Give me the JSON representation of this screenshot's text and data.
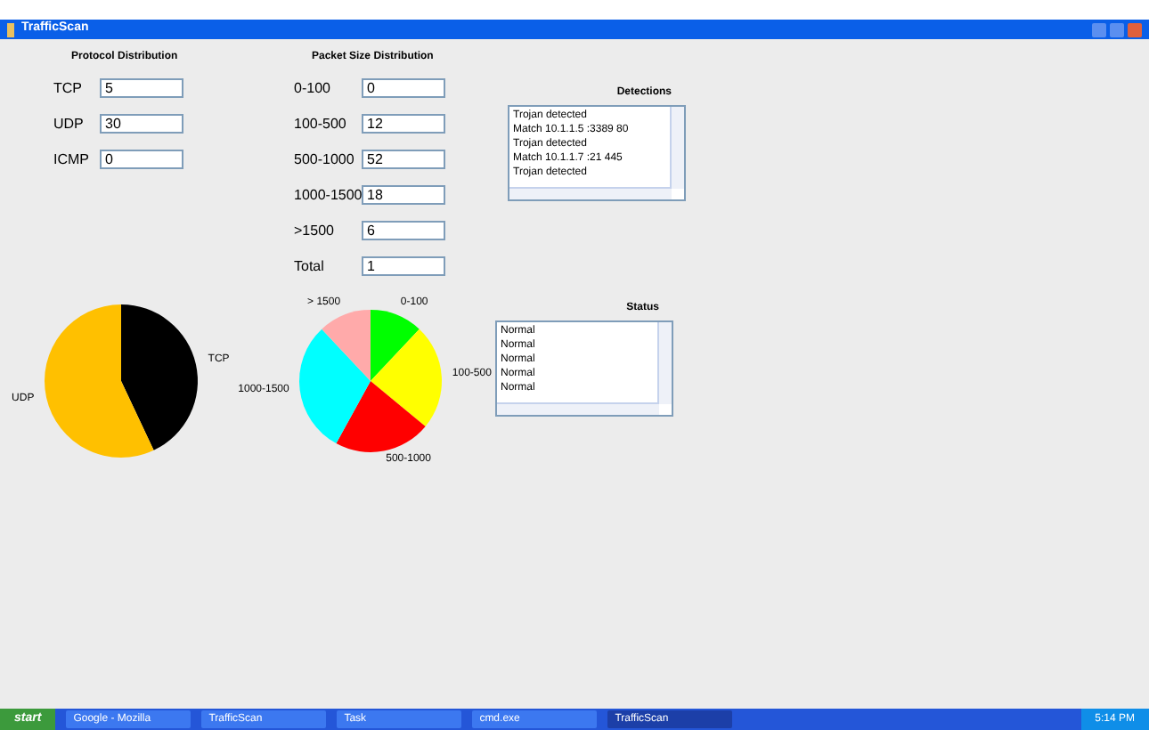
{
  "window": {
    "title": "TrafficScan"
  },
  "protocol": {
    "title": "Protocol Distribution",
    "rows": [
      {
        "label": "TCP",
        "value": "5"
      },
      {
        "label": "UDP",
        "value": "30"
      },
      {
        "label": "ICMP",
        "value": "0"
      }
    ]
  },
  "packet": {
    "title": "Packet Size Distribution",
    "rows": [
      {
        "label": "0-100",
        "value": "0"
      },
      {
        "label": "100-500",
        "value": "12"
      },
      {
        "label": "500-1000",
        "value": "52"
      },
      {
        "label": "1000-1500",
        "value": "18"
      },
      {
        "label": ">1500",
        "value": "6"
      },
      {
        "label": "Total",
        "value": "1"
      }
    ]
  },
  "detections": {
    "title": "Detections",
    "items": [
      "Trojan detected",
      "Match 10.1.1.5 :3389 80",
      "Trojan detected",
      "Match 10.1.1.7 :21 445",
      "Trojan detected"
    ]
  },
  "status": {
    "title": "Status",
    "items": [
      "Normal",
      "Normal",
      "Normal",
      "Normal",
      "Normal"
    ]
  },
  "protocol_pie": [
    {
      "label": "TCP",
      "color": "#000000"
    },
    {
      "label": "UDP",
      "color": "#ffc000"
    }
  ],
  "size_pie": [
    {
      "label": "0-100",
      "color": "#00ff00"
    },
    {
      "label": "100-500",
      "color": "#ffff00"
    },
    {
      "label": "500-1000",
      "color": "#ff0000"
    },
    {
      "label": "1000-1500",
      "color": "#00ffff"
    },
    {
      "label": "> 1500",
      "color": "#ffaaaa"
    }
  ],
  "taskbar": {
    "start": "start",
    "items": [
      {
        "label": "Google - Mozilla",
        "selected": false
      },
      {
        "label": "TrafficScan",
        "selected": false
      },
      {
        "label": "Task",
        "selected": false
      },
      {
        "label": "cmd.exe",
        "selected": false
      },
      {
        "label": "TrafficScan",
        "selected": true
      }
    ],
    "clock": "5:14 PM"
  }
}
